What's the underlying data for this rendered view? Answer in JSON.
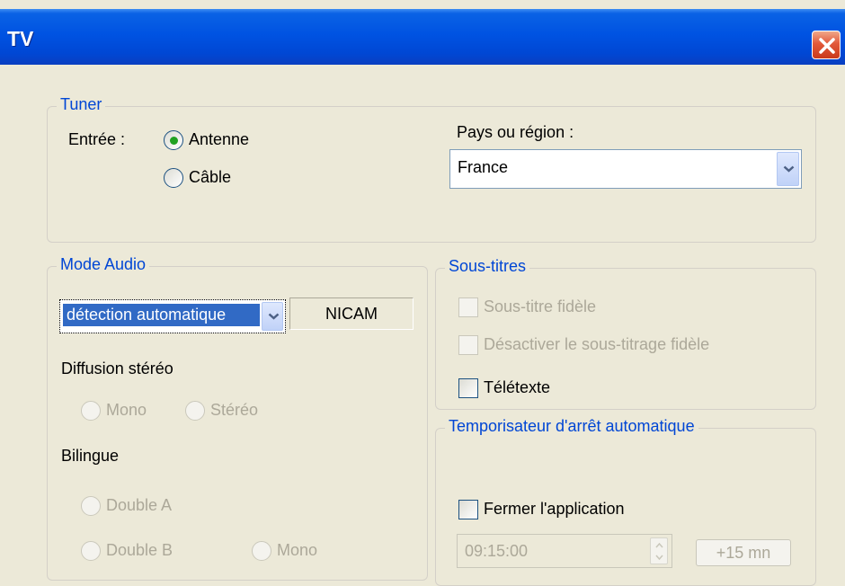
{
  "window": {
    "title": "TV"
  },
  "tuner": {
    "legend": "Tuner",
    "entree_label": "Entrée :",
    "options": [
      "Antenne",
      "Câble"
    ],
    "selected": "Antenne",
    "pays_label": "Pays ou région :",
    "pays_value": "France"
  },
  "audio": {
    "legend": "Mode Audio",
    "mode_value": "détection automatique",
    "nicam": "NICAM",
    "diffusion_label": "Diffusion stéréo",
    "diffusion_options": [
      "Mono",
      "Stéréo"
    ],
    "bilingue_label": "Bilingue",
    "bilingue_options": [
      "Double A",
      "Double B",
      "Mono"
    ]
  },
  "subtitles": {
    "legend": "Sous-titres",
    "items": [
      "Sous-titre fidèle",
      "Désactiver le sous-titrage fidèle",
      "Télétexte"
    ]
  },
  "timer": {
    "legend": "Temporisateur d'arrêt automatique",
    "close_app_label": "Fermer l'application",
    "time_value": "09:15:00",
    "plus_label": "+15 mn"
  },
  "colors": {
    "titlebar": "#0053e2",
    "legend": "#0046d5",
    "disabled": "#aca899",
    "face": "#ece9d8"
  },
  "icons": [
    "close-icon",
    "chevron-down-icon",
    "spin-up-icon",
    "spin-down-icon"
  ]
}
